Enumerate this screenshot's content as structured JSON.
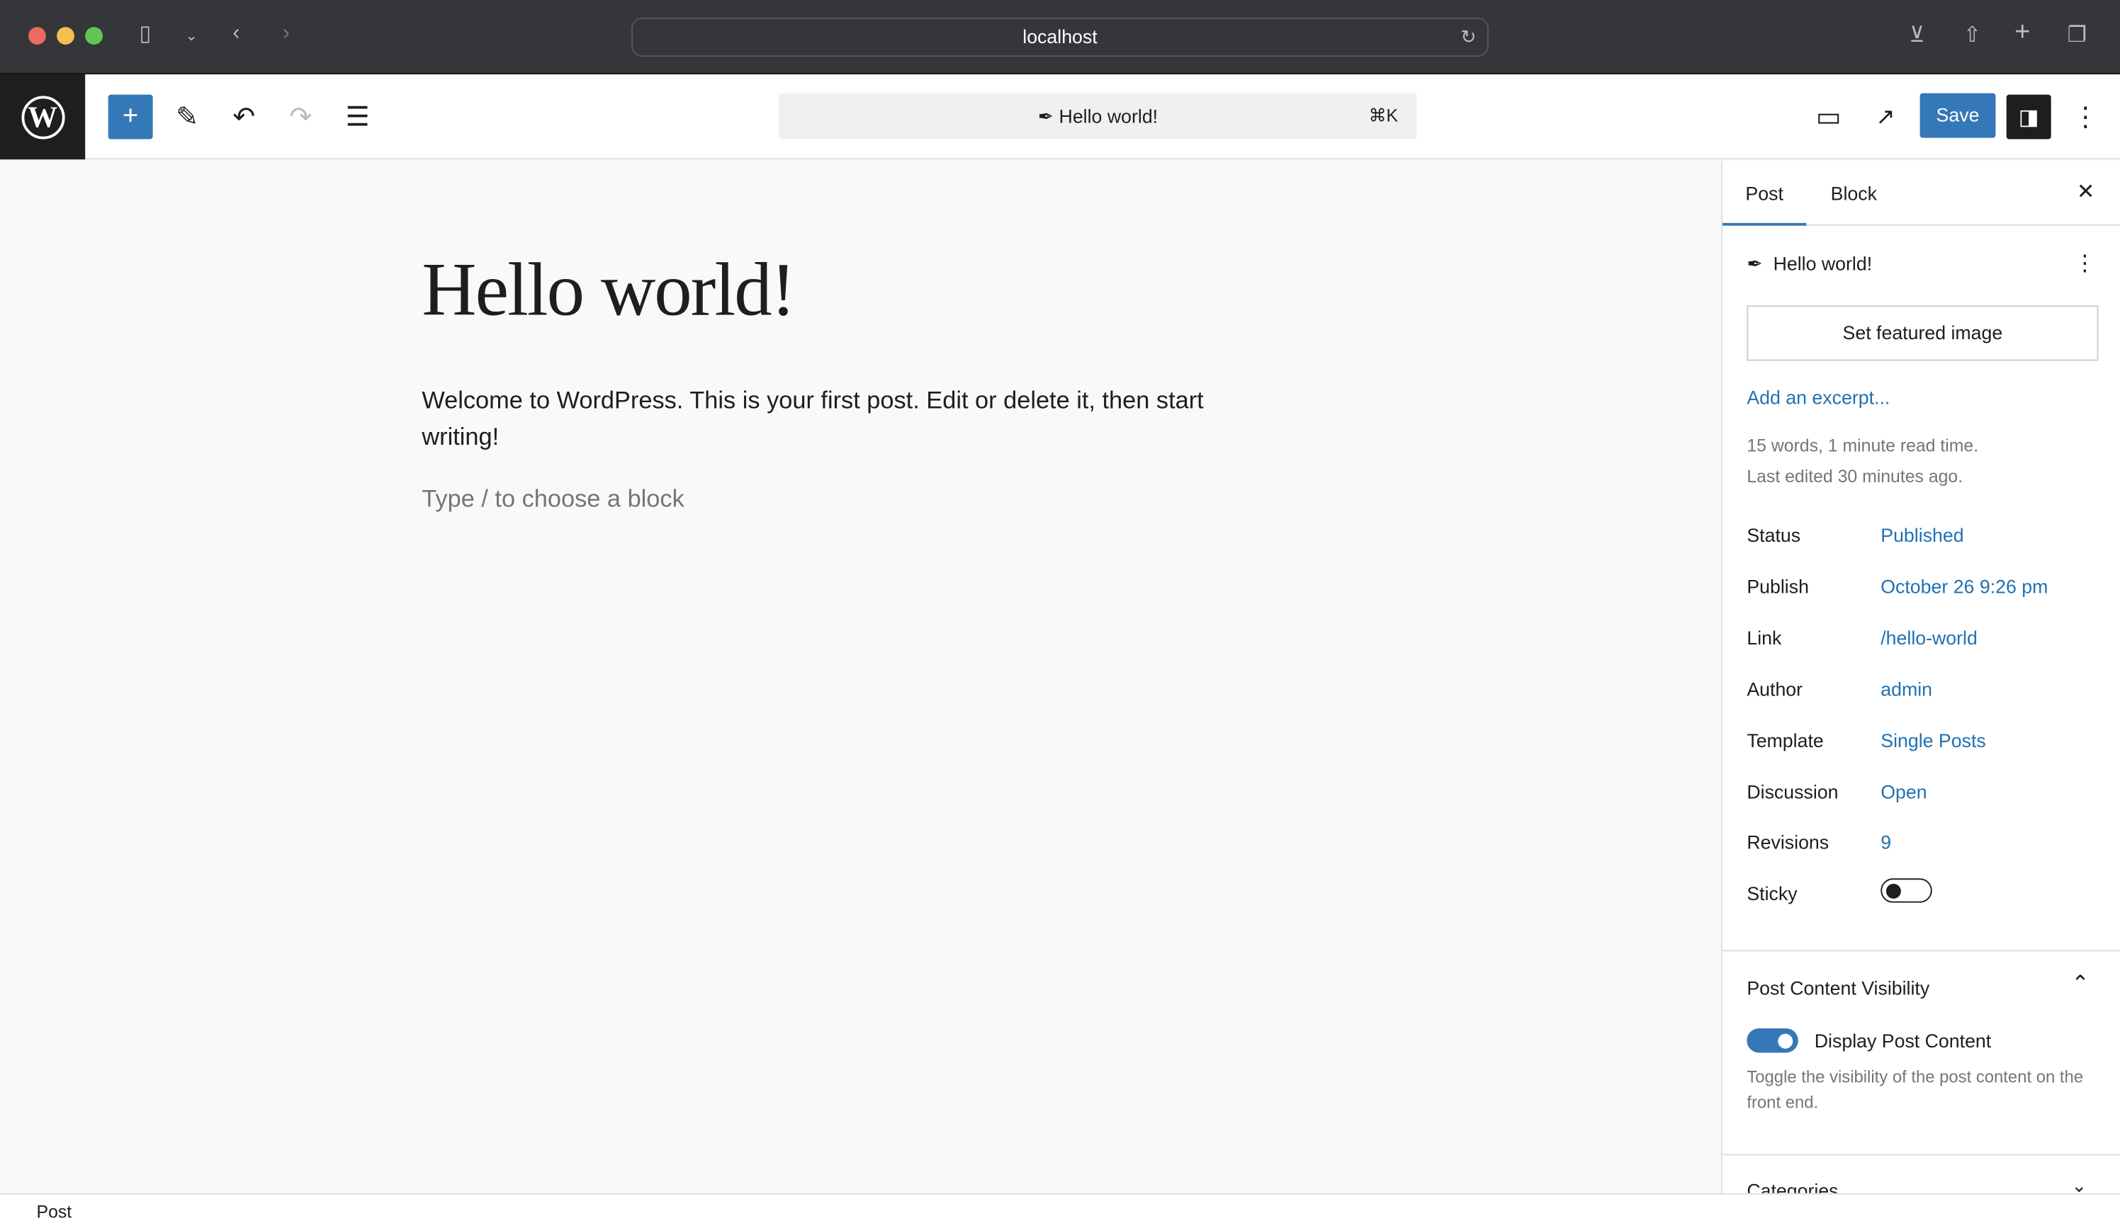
{
  "browser": {
    "url": "localhost"
  },
  "toolbar": {
    "command_title": "Hello world!",
    "shortcut": "⌘K",
    "save_label": "Save"
  },
  "post": {
    "title": "Hello world!",
    "content": "Welcome to WordPress. This is your first post. Edit or delete it, then start writing!",
    "placeholder": "Type / to choose a block"
  },
  "sidebar": {
    "tabs": [
      "Post",
      "Block"
    ],
    "post_title": "Hello world!",
    "featured_image": "Set featured image",
    "excerpt_link": "Add an excerpt...",
    "stats": "15 words, 1 minute read time.",
    "last_edited": "Last edited 30 minutes ago.",
    "fields": [
      {
        "label": "Status",
        "value": "Published"
      },
      {
        "label": "Publish",
        "value": "October 26 9:26 pm"
      },
      {
        "label": "Link",
        "value": "/hello-world"
      },
      {
        "label": "Author",
        "value": "admin"
      },
      {
        "label": "Template",
        "value": "Single Posts"
      },
      {
        "label": "Discussion",
        "value": "Open"
      },
      {
        "label": "Revisions",
        "value": "9"
      }
    ],
    "sticky_label": "Sticky",
    "sticky_on": false,
    "visibility": {
      "title": "Post Content Visibility",
      "toggle_label": "Display Post Content",
      "toggle_on": true,
      "help": "Toggle the visibility of the post content on the front end."
    },
    "categories_title": "Categories"
  },
  "footer": {
    "breadcrumb": "Post"
  },
  "colors": {
    "accent": "#3578b7",
    "link": "#2271b1"
  }
}
